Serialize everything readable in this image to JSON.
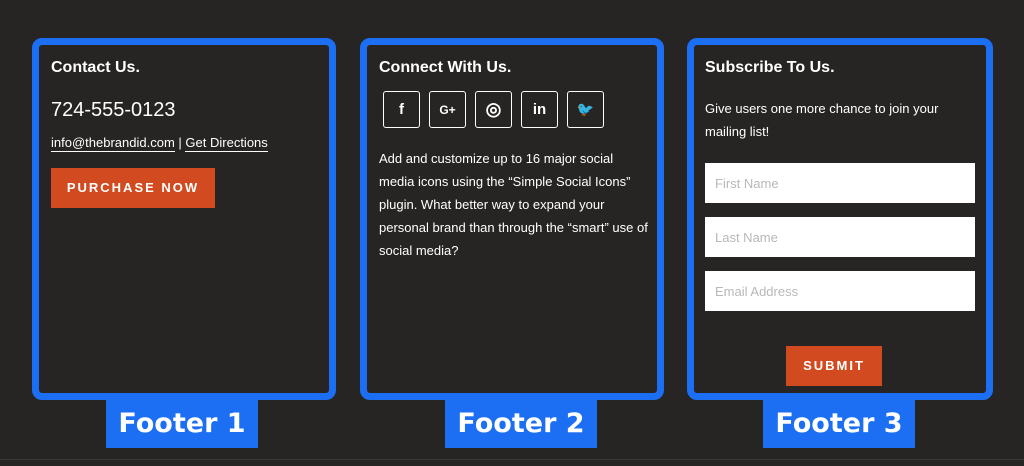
{
  "footer1": {
    "title": "Contact Us.",
    "phone": "724-555-0123",
    "email": "info@thebrandid.com",
    "separator": "|",
    "directions": "Get Directions",
    "button": "PURCHASE NOW",
    "label": "Footer 1"
  },
  "footer2": {
    "title": "Connect With Us.",
    "socials": [
      {
        "icon": "facebook-icon",
        "glyph": "f"
      },
      {
        "icon": "google-plus-icon",
        "glyph": "G+"
      },
      {
        "icon": "instagram-icon",
        "glyph": "◎"
      },
      {
        "icon": "linkedin-icon",
        "glyph": "in"
      },
      {
        "icon": "twitter-icon",
        "glyph": "🐦"
      }
    ],
    "text": "Add and customize up to 16 major social media icons using the “Simple Social Icons” plugin. What better way to expand your personal brand than through the “smart” use of social media?",
    "label": "Footer 2"
  },
  "footer3": {
    "title": "Subscribe To Us.",
    "text": "Give users one more chance to join your mailing list!",
    "first_name_placeholder": "First Name",
    "last_name_placeholder": "Last Name",
    "email_placeholder": "Email Address",
    "button": "SUBMIT",
    "label": "Footer 3"
  },
  "colors": {
    "background": "#272523",
    "frame": "#1c6ef2",
    "button": "#d24b20"
  }
}
